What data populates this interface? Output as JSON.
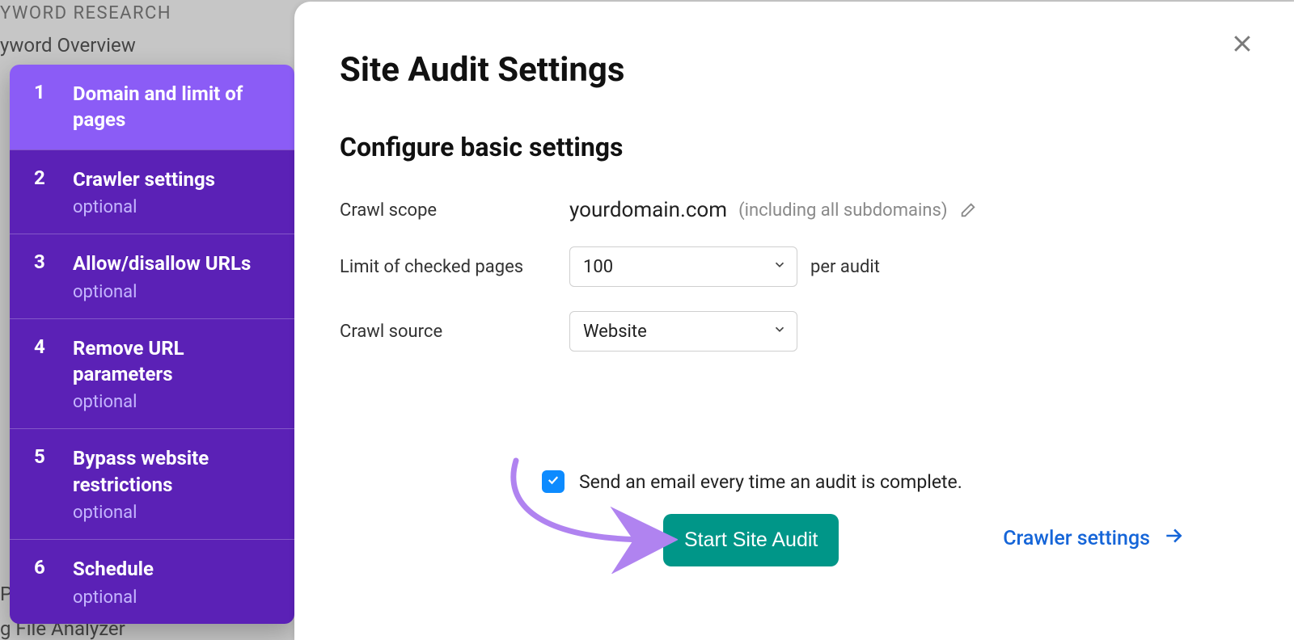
{
  "background": {
    "heading": "YWORD RESEARCH",
    "items": [
      "yword Overview",
      "Page SEO Checker",
      "g File Analyzer"
    ]
  },
  "steps": [
    {
      "num": "1",
      "title": "Domain and limit of pages",
      "optional": ""
    },
    {
      "num": "2",
      "title": "Crawler settings",
      "optional": "optional"
    },
    {
      "num": "3",
      "title": "Allow/disallow URLs",
      "optional": "optional"
    },
    {
      "num": "4",
      "title": "Remove URL parameters",
      "optional": "optional"
    },
    {
      "num": "5",
      "title": "Bypass website restrictions",
      "optional": "optional"
    },
    {
      "num": "6",
      "title": "Schedule",
      "optional": "optional"
    }
  ],
  "modal": {
    "title": "Site Audit Settings",
    "subtitle": "Configure basic settings",
    "crawl_scope_label": "Crawl scope",
    "crawl_scope_value": "yourdomain.com",
    "crawl_scope_note": "(including all subdomains)",
    "limit_label": "Limit of checked pages",
    "limit_value": "100",
    "limit_suffix": "per audit",
    "source_label": "Crawl source",
    "source_value": "Website",
    "email_label": "Send an email every time an audit is complete.",
    "start_button": "Start Site Audit",
    "crawler_link": "Crawler settings"
  }
}
